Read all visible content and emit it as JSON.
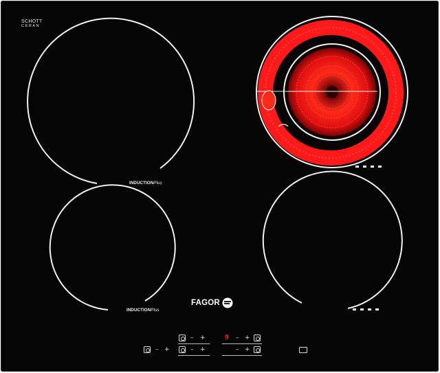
{
  "panel": {
    "brand_top_line1": "SCHOTT",
    "brand_top_line2": "CERAN",
    "logo": "FAGOR",
    "induction_label_main": "INDUCTION",
    "induction_label_plus": "Plus"
  },
  "zones": {
    "top_left": {
      "type": "induction",
      "active": false
    },
    "bottom_left": {
      "type": "induction",
      "active": false
    },
    "top_right": {
      "type": "radiant-dual",
      "active": true,
      "glow_color": "#ff1a1a"
    },
    "bottom_right": {
      "type": "radiant",
      "active": false
    }
  },
  "controls": {
    "display_value": "9",
    "minus": "–",
    "plus": "+"
  },
  "colors": {
    "glass": "#050505",
    "outline": "#f2f2f2",
    "heat": "#ff1a1a",
    "display": "#ff2020"
  }
}
